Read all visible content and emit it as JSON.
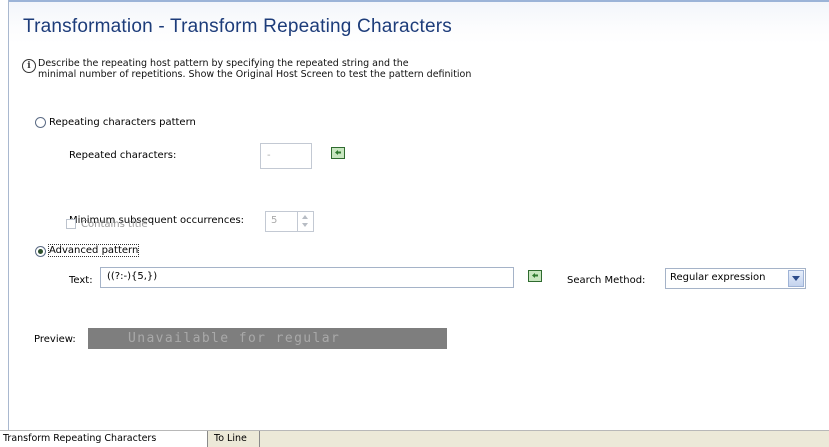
{
  "header": {
    "title": "Transformation - Transform Repeating Characters"
  },
  "description": {
    "line1": "Describe the repeating host pattern by specifying the repeated string and the",
    "line2": "minimal number of repetitions. Show the Original Host Screen to test the pattern definition"
  },
  "repeating": {
    "radio_label": "Repeating characters pattern",
    "checked": false,
    "chars_label": "Repeated characters:",
    "chars_value": "-",
    "min_label": "Minimum subsequent occurrences:",
    "min_value": "5",
    "contains_title_label": "Contains title"
  },
  "advanced": {
    "radio_label": "Advanced pattern",
    "checked": true,
    "text_label": "Text:",
    "text_value": "((?:-){5,})",
    "search_label": "Search Method:",
    "search_value": "Regular expression"
  },
  "preview": {
    "label": "Preview:",
    "text": "Unavailable for regular"
  },
  "tabs": [
    {
      "label": "Transform Repeating Characters",
      "active": true
    },
    {
      "label": "To Line",
      "active": false
    }
  ],
  "icons": {
    "info": "info-icon",
    "insert": "insert-arrow-icon",
    "dropdown": "chevron-down-icon"
  },
  "colors": {
    "title": "#1d3c7a",
    "preview_background": "#7e7e7e",
    "tabbar": "#ece9d8"
  }
}
